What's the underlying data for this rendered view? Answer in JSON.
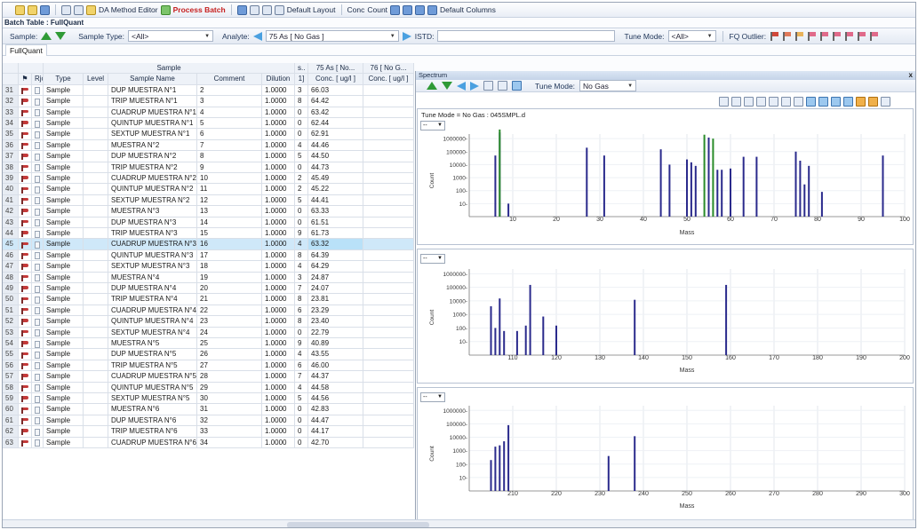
{
  "toolbar": {
    "da_method_editor": "DA Method Editor",
    "process_batch": "Process Batch",
    "default_layout": "Default Layout",
    "conc": "Conc",
    "count": "Count",
    "default_columns": "Default Columns"
  },
  "batch_table_title": "Batch Table : FullQuant",
  "filter_bar": {
    "sample_label": "Sample:",
    "sample_type_label": "Sample Type:",
    "sample_type_value": "<All>",
    "analyte_label": "Analyte:",
    "analyte_value": "75  As  [ No Gas ]",
    "istd_label": "ISTD:",
    "tune_mode_label": "Tune Mode:",
    "tune_mode_value": "<All>",
    "fq_outlier_label": "FQ Outlier:"
  },
  "tab": "FullQuant",
  "grid": {
    "group_header_sample": "Sample",
    "group_header_trunc": "s..",
    "group_header_as": "75  As  [ No...",
    "group_header_76": "76  [ No G...",
    "columns": [
      "",
      "",
      "Rjct",
      "Type",
      "Level",
      "Sample Name",
      "Comment",
      "Dilution",
      "1]",
      "Conc. [ ug/l ]",
      "Conc. [ ug/l ]"
    ],
    "rows": [
      {
        "n": "31",
        "type": "Sample",
        "name": "DUP MUESTRA N°1",
        "comment": "2",
        "dil": "1.0000",
        "d": "3",
        "conc": "66.03"
      },
      {
        "n": "32",
        "type": "Sample",
        "name": "TRIP MUESTRA N°1",
        "comment": "3",
        "dil": "1.0000",
        "d": "8",
        "conc": "64.42"
      },
      {
        "n": "33",
        "type": "Sample",
        "name": "CUADRUP MUESTRA N°1",
        "comment": "4",
        "dil": "1.0000",
        "d": "0",
        "conc": "63.42"
      },
      {
        "n": "34",
        "type": "Sample",
        "name": "QUINTUP MUESTRA N°1",
        "comment": "5",
        "dil": "1.0000",
        "d": "0",
        "conc": "62.44"
      },
      {
        "n": "35",
        "type": "Sample",
        "name": "SEXTUP MUESTRA N°1",
        "comment": "6",
        "dil": "1.0000",
        "d": "0",
        "conc": "62.91"
      },
      {
        "n": "36",
        "type": "Sample",
        "name": "MUESTRA N°2",
        "comment": "7",
        "dil": "1.0000",
        "d": "4",
        "conc": "44.46"
      },
      {
        "n": "37",
        "type": "Sample",
        "name": "DUP MUESTRA N°2",
        "comment": "8",
        "dil": "1.0000",
        "d": "5",
        "conc": "44.50"
      },
      {
        "n": "38",
        "type": "Sample",
        "name": "TRIP MUESTRA N°2",
        "comment": "9",
        "dil": "1.0000",
        "d": "0",
        "conc": "44.73"
      },
      {
        "n": "39",
        "type": "Sample",
        "name": "CUADRUP MUESTRA N°2",
        "comment": "10",
        "dil": "1.0000",
        "d": "2",
        "conc": "45.49"
      },
      {
        "n": "40",
        "type": "Sample",
        "name": "QUINTUP MUESTRA N°2",
        "comment": "11",
        "dil": "1.0000",
        "d": "2",
        "conc": "45.22"
      },
      {
        "n": "41",
        "type": "Sample",
        "name": "SEXTUP MUESTRA N°2",
        "comment": "12",
        "dil": "1.0000",
        "d": "5",
        "conc": "44.41"
      },
      {
        "n": "42",
        "type": "Sample",
        "name": "MUESTRA N°3",
        "comment": "13",
        "dil": "1.0000",
        "d": "0",
        "conc": "63.33"
      },
      {
        "n": "43",
        "type": "Sample",
        "name": "DUP MUESTRA N°3",
        "comment": "14",
        "dil": "1.0000",
        "d": "0",
        "conc": "61.51"
      },
      {
        "n": "44",
        "type": "Sample",
        "name": "TRIP MUESTRA N°3",
        "comment": "15",
        "dil": "1.0000",
        "d": "9",
        "conc": "61.73"
      },
      {
        "n": "45",
        "type": "Sample",
        "name": "CUADRUP MUESTRA N°3",
        "comment": "16",
        "dil": "1.0000",
        "d": "4",
        "conc": "63.32",
        "selected": true
      },
      {
        "n": "46",
        "type": "Sample",
        "name": "QUINTUP MUESTRA N°3",
        "comment": "17",
        "dil": "1.0000",
        "d": "8",
        "conc": "64.39"
      },
      {
        "n": "47",
        "type": "Sample",
        "name": "SEXTUP MUESTRA N°3",
        "comment": "18",
        "dil": "1.0000",
        "d": "4",
        "conc": "64.29"
      },
      {
        "n": "48",
        "type": "Sample",
        "name": "MUESTRA N°4",
        "comment": "19",
        "dil": "1.0000",
        "d": "3",
        "conc": "24.87"
      },
      {
        "n": "49",
        "type": "Sample",
        "name": "DUP MUESTRA N°4",
        "comment": "20",
        "dil": "1.0000",
        "d": "7",
        "conc": "24.07"
      },
      {
        "n": "50",
        "type": "Sample",
        "name": "TRIP MUESTRA N°4",
        "comment": "21",
        "dil": "1.0000",
        "d": "8",
        "conc": "23.81"
      },
      {
        "n": "51",
        "type": "Sample",
        "name": "CUADRUP MUESTRA N°4",
        "comment": "22",
        "dil": "1.0000",
        "d": "6",
        "conc": "23.29"
      },
      {
        "n": "52",
        "type": "Sample",
        "name": "QUINTUP MUESTRA N°4",
        "comment": "23",
        "dil": "1.0000",
        "d": "8",
        "conc": "23.40"
      },
      {
        "n": "53",
        "type": "Sample",
        "name": "SEXTUP MUESTRA N°4",
        "comment": "24",
        "dil": "1.0000",
        "d": "0",
        "conc": "22.79"
      },
      {
        "n": "54",
        "type": "Sample",
        "name": "MUESTRA N°5",
        "comment": "25",
        "dil": "1.0000",
        "d": "9",
        "conc": "40.89"
      },
      {
        "n": "55",
        "type": "Sample",
        "name": "DUP MUESTRA N°5",
        "comment": "26",
        "dil": "1.0000",
        "d": "4",
        "conc": "43.55"
      },
      {
        "n": "56",
        "type": "Sample",
        "name": "TRIP MUESTRA N°5",
        "comment": "27",
        "dil": "1.0000",
        "d": "6",
        "conc": "46.00"
      },
      {
        "n": "57",
        "type": "Sample",
        "name": "CUADRUP MUESTRA N°5",
        "comment": "28",
        "dil": "1.0000",
        "d": "7",
        "conc": "44.37"
      },
      {
        "n": "58",
        "type": "Sample",
        "name": "QUINTUP MUESTRA N°5",
        "comment": "29",
        "dil": "1.0000",
        "d": "4",
        "conc": "44.58"
      },
      {
        "n": "59",
        "type": "Sample",
        "name": "SEXTUP MUESTRA N°5",
        "comment": "30",
        "dil": "1.0000",
        "d": "5",
        "conc": "44.56"
      },
      {
        "n": "60",
        "type": "Sample",
        "name": "MUESTRA N°6",
        "comment": "31",
        "dil": "1.0000",
        "d": "0",
        "conc": "42.83"
      },
      {
        "n": "61",
        "type": "Sample",
        "name": "DUP MUESTRA N°6",
        "comment": "32",
        "dil": "1.0000",
        "d": "0",
        "conc": "44.47"
      },
      {
        "n": "62",
        "type": "Sample",
        "name": "TRIP MUESTRA N°6",
        "comment": "33",
        "dil": "1.0000",
        "d": "0",
        "conc": "44.17"
      },
      {
        "n": "63",
        "type": "Sample",
        "name": "CUADRUP MUESTRA N°6",
        "comment": "34",
        "dil": "1.0000",
        "d": "0",
        "conc": "42.70"
      }
    ]
  },
  "spectrum": {
    "title": "Spectrum",
    "close": "x",
    "tune_mode_label": "Tune Mode:",
    "tune_mode_value": "No Gas",
    "panel_caption": "Tune Mode =  No Gas : 045SMPL.d",
    "dropdown_value": "--"
  },
  "chart_data": [
    {
      "type": "bar",
      "xlabel": "Mass",
      "ylabel": "Count",
      "xlim": [
        0,
        100
      ],
      "xticks": [
        10,
        20,
        30,
        40,
        50,
        60,
        70,
        80,
        90,
        100
      ],
      "yticks": [
        "10-",
        "100-",
        "1000-",
        "10000-",
        "100000-",
        "1000000-"
      ],
      "ylog": true,
      "grid": true,
      "series": [
        {
          "color": "#2a2a8c",
          "x": [
            6,
            7,
            9,
            27,
            31,
            44,
            46,
            50,
            51,
            52,
            55,
            57,
            58,
            60,
            63,
            66,
            75,
            76,
            77,
            78,
            81,
            95
          ],
          "values": [
            50000,
            3000000,
            10,
            200000,
            50000,
            150000,
            10000,
            25000,
            15000,
            8000,
            1200000,
            4000,
            4000,
            5000,
            40000,
            40000,
            100000,
            20000,
            300,
            8000,
            80,
            50000
          ]
        },
        {
          "color": "#2a8c2a",
          "x": [
            7,
            54,
            56
          ],
          "values": [
            5000000,
            2000000,
            1000000
          ]
        }
      ]
    },
    {
      "type": "bar",
      "xlabel": "Mass",
      "ylabel": "Count",
      "xlim": [
        100,
        200
      ],
      "xticks": [
        110,
        120,
        130,
        140,
        150,
        160,
        170,
        180,
        190,
        200
      ],
      "yticks": [
        "10-",
        "100-",
        "1000-",
        "10000-",
        "100000-",
        "1000000-"
      ],
      "ylog": true,
      "grid": true,
      "series": [
        {
          "color": "#2a2a8c",
          "x": [
            105,
            106,
            107,
            108,
            111,
            113,
            114,
            117,
            120,
            138,
            159
          ],
          "values": [
            4000,
            100,
            15000,
            60,
            60,
            150,
            150000,
            700,
            150,
            12000,
            150000
          ]
        }
      ]
    },
    {
      "type": "bar",
      "xlabel": "Mass",
      "ylabel": "Count",
      "xlim": [
        200,
        300
      ],
      "xticks": [
        210,
        220,
        230,
        240,
        250,
        260,
        270,
        280,
        290,
        300
      ],
      "yticks": [
        "10-",
        "100-",
        "1000-",
        "10000-",
        "100000-",
        "1000000-"
      ],
      "ylog": true,
      "grid": true,
      "series": [
        {
          "color": "#2a2a8c",
          "x": [
            205,
            206,
            207,
            208,
            209,
            232,
            238
          ],
          "values": [
            200,
            2000,
            2500,
            5000,
            80000,
            400,
            12000
          ]
        }
      ]
    }
  ]
}
